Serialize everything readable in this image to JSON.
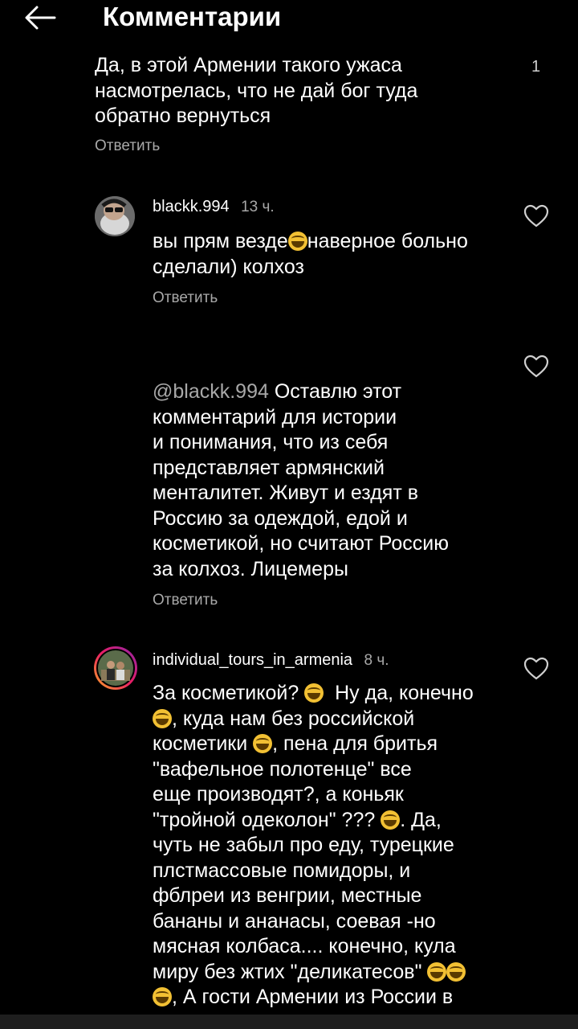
{
  "header": {
    "title": "Комментарии"
  },
  "comments": [
    {
      "lines": [
        "Да, в этой Армении такого ужаса",
        "насмотрелась, что не дай бог туда",
        "обратно вернуться"
      ],
      "reply_label": "Ответить",
      "likes": "1"
    },
    {
      "username": "blackk.994",
      "time": "13 ч.",
      "lines": [
        "вы прям везде",
        "наверное больно",
        "сделали) колхоз"
      ],
      "reply_label": "Ответить"
    },
    {
      "mention": "@blackk.994",
      "lines": [
        "Оставлю этот",
        "комментарий для истории",
        "и понимания, что из себя",
        "представляет армянский",
        "менталитет. Живут и ездят в",
        "Россию за одеждой, едой и",
        "косметикой, но считают Россию",
        "за колхоз. Лицемеры"
      ],
      "reply_label": "Ответить"
    },
    {
      "username": "individual_tours_in_armenia",
      "time": "8 ч.",
      "lines": [
        "За косметикой?",
        "Ну да, конечно",
        ", куда нам без российской",
        "косметики",
        ", пена для бритья",
        "\"вафельное полотенце\" все",
        "еще производят?, а коньяк",
        "\"тройной одеколон\" ???",
        ". Да,",
        "чуть не забыл про еду, турецкие",
        "плстмассовые помидоры, и",
        "фблреи из венгрии, местные",
        "бананы и ананасы, соевая -но",
        "мясная колбаса.... конечно, кула",
        "миру без жтих \"деликатесов\"",
        ", А гости Армении из России в"
      ]
    }
  ],
  "icons": {
    "back": "arrow-left-icon",
    "heart": "heart-outline-icon",
    "emoji": "grinning-squinting-face"
  }
}
